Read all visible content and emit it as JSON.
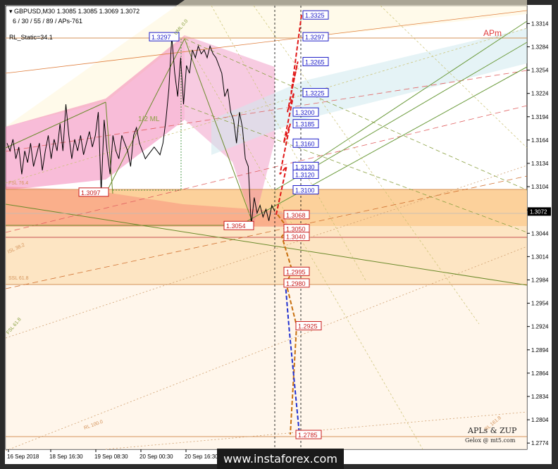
{
  "header": {
    "symbol_line": "GBPUSD,M30  1.3085 1.3085 1.3069 1.3072",
    "params_line": "6 / 30 / 55 / 89 / APs-761",
    "indicator": "RL_Static=34.1"
  },
  "apm_label": "APm",
  "credits": {
    "title": "APLs & ZUP",
    "author": "Gelox @ mt5.com"
  },
  "watermark": "www.instaforex.com",
  "chart_data": {
    "type": "line",
    "title": "",
    "ylim": [
      1.2766,
      1.3337
    ],
    "y_ticks": [
      "1.3314",
      "1.3284",
      "1.3254",
      "1.3224",
      "1.3194",
      "1.3164",
      "1.3134",
      "1.3104",
      "1.3074",
      "1.3044",
      "1.3014",
      "1.2984",
      "1.2954",
      "1.2924",
      "1.2894",
      "1.2864",
      "1.2834",
      "1.2804",
      "1.2774"
    ],
    "current_price": "1.3072",
    "x_labels": [
      "16 Sep 2018",
      "18 Sep 16:30",
      "19 Sep 08:30",
      "20 Sep 00:30",
      "20 Sep 16:30"
    ],
    "pivots": [
      {
        "label": "1.3297",
        "price": 1.3297,
        "color": "#1c1cc8"
      },
      {
        "label": "1.3097",
        "price": 1.3097,
        "color": "#c81c1c"
      },
      {
        "label": "1.3054",
        "price": 1.3054,
        "color": "#c81c1c"
      }
    ],
    "upper_levels": [
      {
        "label": "1.3325",
        "price": 1.3325
      },
      {
        "label": "1.3297",
        "price": 1.3297
      },
      {
        "label": "1.3265",
        "price": 1.3265
      },
      {
        "label": "1.3225",
        "price": 1.3225
      },
      {
        "label": "1.3200",
        "price": 1.32
      },
      {
        "label": "1.3185",
        "price": 1.3185
      },
      {
        "label": "1.3160",
        "price": 1.316
      },
      {
        "label": "1.3130",
        "price": 1.313
      },
      {
        "label": "1.3120",
        "price": 1.312
      },
      {
        "label": "1.3100",
        "price": 1.31
      }
    ],
    "lower_levels": [
      {
        "label": "1.3068",
        "price": 1.3068
      },
      {
        "label": "1.3050",
        "price": 1.305
      },
      {
        "label": "1.3040",
        "price": 1.304
      },
      {
        "label": "1.2995",
        "price": 1.2995
      },
      {
        "label": "1.2980",
        "price": 1.298
      },
      {
        "label": "1.2925",
        "price": 1.2925
      },
      {
        "label": "1.2785",
        "price": 1.2785
      }
    ],
    "zone_labels": [
      "1/2 ML",
      "FSL 76.4",
      "SSL 61.8",
      "ISL 38.2",
      "RL 100.0",
      "RL 161.8",
      "UML 0.0",
      "FSL 61.8"
    ],
    "price_series": [
      1.316,
      1.315,
      1.3165,
      1.314,
      1.3155,
      1.312,
      1.315,
      1.3135,
      1.316,
      1.313,
      1.3145,
      1.316,
      1.3125,
      1.315,
      1.317,
      1.314,
      1.3165,
      1.315,
      1.3185,
      1.315,
      1.321,
      1.317,
      1.314,
      1.3165,
      1.315,
      1.317,
      1.3145,
      1.316,
      1.3175,
      1.3155,
      1.317,
      1.32,
      1.3097,
      1.319,
      1.315,
      1.312,
      1.317,
      1.315,
      1.314,
      1.317,
      1.316,
      1.315,
      1.313,
      1.317,
      1.318,
      1.316,
      1.315,
      1.314,
      1.3145,
      1.315,
      1.3155,
      1.315,
      1.3145,
      1.316,
      1.319,
      1.323,
      1.3297,
      1.325,
      1.322,
      1.327,
      1.321,
      1.326,
      1.325,
      1.328,
      1.327,
      1.3285,
      1.3275,
      1.328,
      1.327,
      1.3285,
      1.3275,
      1.327,
      1.326,
      1.325,
      1.322,
      1.323,
      1.32,
      1.319,
      1.316,
      1.32,
      1.318,
      1.314,
      1.313,
      1.3054,
      1.309,
      1.307,
      1.308,
      1.3065,
      1.3075,
      1.306,
      1.308,
      1.3072
    ],
    "forecast_up": [
      1.3068,
      1.313,
      1.312,
      1.3185,
      1.316,
      1.3225,
      1.32,
      1.3265,
      1.3225,
      1.3325
    ],
    "forecast_down": [
      1.3068,
      1.305,
      1.304,
      1.2995,
      1.298,
      1.2925,
      1.2785
    ]
  }
}
